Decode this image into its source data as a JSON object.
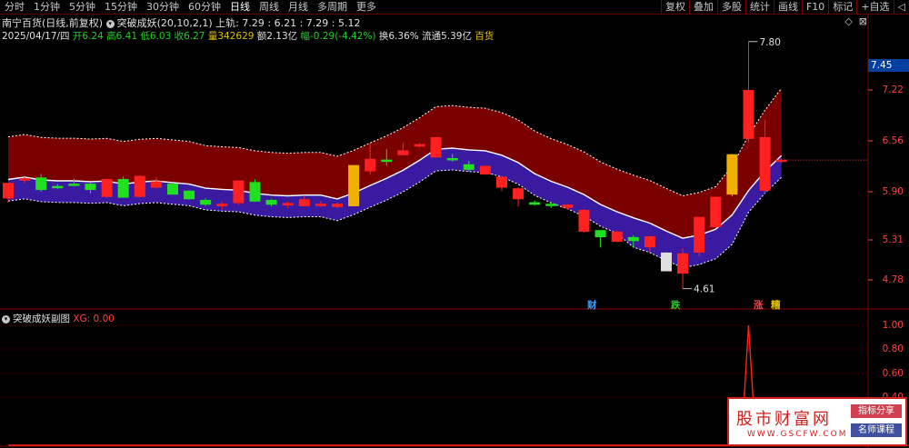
{
  "tabs": [
    "分时",
    "1分钟",
    "5分钟",
    "15分钟",
    "30分钟",
    "60分钟",
    "日线",
    "周线",
    "月线",
    "多周期",
    "更多"
  ],
  "active_tab": 6,
  "tools": [
    "复权",
    "叠加",
    "多股",
    "统计",
    "画线",
    "F10",
    "标记",
    "+自选",
    "◁"
  ],
  "header": {
    "stock_name": "南宁百货",
    "period_label": "(日线,前复权)",
    "indicator_name": "突破成妖",
    "indicator_params": "(20,10,2,1)",
    "upper_label": "上轨: 7.29",
    "vals": [
      ": 6.21",
      ": 7.29",
      ": 5.12"
    ]
  },
  "info": {
    "date": "2025/04/17/四",
    "open": "开6.24",
    "high": "高6.41",
    "low": "低6.03",
    "close": "收6.27",
    "volume": "量342629",
    "amount": "额2.13亿",
    "change": "幅-0.29(-4.42%)",
    "turnover": "换6.36%",
    "float": "流通5.39亿",
    "sector": "百货"
  },
  "sub_indicator": {
    "name": "突破成妖副图",
    "value": "XG: 0.00"
  },
  "price_axis": [
    "7.22",
    "6.56",
    "5.90",
    "5.31",
    "4.78"
  ],
  "sub_axis": [
    "1.00",
    "0.80",
    "0.60",
    "0.40"
  ],
  "current_price": "7.45",
  "annotations": {
    "high": "7.80",
    "low": "4.61"
  },
  "signals": [
    {
      "text": "财",
      "color": "#40a0ff"
    },
    {
      "text": "跌",
      "color": "#20d020"
    },
    {
      "text": "涨",
      "color": "#ff4040"
    },
    {
      "text": "糟",
      "color": "#e0c000"
    }
  ],
  "logo": {
    "main": "股市财富网",
    "sub": "WWW.GSCFW.COM",
    "tag1": "指标分享",
    "tag2": "名师课程"
  },
  "chart_data": {
    "type": "candlestick",
    "ylim": [
      4.5,
      7.95
    ],
    "candles": [
      {
        "o": 5.78,
        "h": 5.98,
        "l": 5.72,
        "c": 5.97
      },
      {
        "o": 6.01,
        "h": 6.05,
        "l": 5.97,
        "c": 6.03
      },
      {
        "o": 6.04,
        "h": 6.09,
        "l": 5.86,
        "c": 5.89
      },
      {
        "o": 5.93,
        "h": 5.96,
        "l": 5.9,
        "c": 5.92
      },
      {
        "o": 5.96,
        "h": 6.03,
        "l": 5.93,
        "c": 5.95
      },
      {
        "o": 5.96,
        "h": 5.98,
        "l": 5.84,
        "c": 5.89
      },
      {
        "o": 5.8,
        "h": 6.03,
        "l": 5.78,
        "c": 6.02
      },
      {
        "o": 6.02,
        "h": 6.06,
        "l": 5.79,
        "c": 5.79
      },
      {
        "o": 5.8,
        "h": 6.07,
        "l": 5.79,
        "c": 6.06
      },
      {
        "o": 5.92,
        "h": 6.05,
        "l": 5.9,
        "c": 5.99
      },
      {
        "o": 5.96,
        "h": 5.98,
        "l": 5.82,
        "c": 5.83
      },
      {
        "o": 5.87,
        "h": 5.87,
        "l": 5.76,
        "c": 5.77
      },
      {
        "o": 5.75,
        "h": 5.78,
        "l": 5.68,
        "c": 5.7
      },
      {
        "o": 5.68,
        "h": 5.73,
        "l": 5.63,
        "c": 5.7
      },
      {
        "o": 5.72,
        "h": 6.01,
        "l": 5.69,
        "c": 6.0
      },
      {
        "o": 5.98,
        "h": 6.02,
        "l": 5.73,
        "c": 5.74
      },
      {
        "o": 5.75,
        "h": 5.77,
        "l": 5.67,
        "c": 5.7
      },
      {
        "o": 5.69,
        "h": 5.73,
        "l": 5.65,
        "c": 5.71
      },
      {
        "o": 5.68,
        "h": 5.8,
        "l": 5.67,
        "c": 5.76
      },
      {
        "o": 5.69,
        "h": 5.74,
        "l": 5.66,
        "c": 5.7
      },
      {
        "o": 5.67,
        "h": 5.72,
        "l": 5.65,
        "c": 5.7
      },
      {
        "o": 5.68,
        "h": 6.2,
        "l": 5.67,
        "c": 6.2
      },
      {
        "o": 6.13,
        "h": 6.49,
        "l": 6.08,
        "c": 6.28
      },
      {
        "o": 6.27,
        "h": 6.41,
        "l": 6.2,
        "c": 6.26
      },
      {
        "o": 6.34,
        "h": 6.49,
        "l": 6.33,
        "c": 6.39
      },
      {
        "o": 6.45,
        "h": 6.49,
        "l": 6.43,
        "c": 6.47
      },
      {
        "o": 6.31,
        "h": 6.56,
        "l": 6.3,
        "c": 6.56
      },
      {
        "o": 6.29,
        "h": 6.35,
        "l": 6.25,
        "c": 6.28
      },
      {
        "o": 6.21,
        "h": 6.26,
        "l": 6.12,
        "c": 6.15
      },
      {
        "o": 6.09,
        "h": 6.2,
        "l": 6.08,
        "c": 6.19
      },
      {
        "o": 5.92,
        "h": 5.99,
        "l": 5.87,
        "c": 6.05
      },
      {
        "o": 5.77,
        "h": 5.92,
        "l": 5.67,
        "c": 5.9
      },
      {
        "o": 5.72,
        "h": 5.75,
        "l": 5.68,
        "c": 5.7
      },
      {
        "o": 5.7,
        "h": 5.73,
        "l": 5.65,
        "c": 5.69
      },
      {
        "o": 5.66,
        "h": 5.7,
        "l": 5.63,
        "c": 5.69
      },
      {
        "o": 5.35,
        "h": 5.64,
        "l": 5.33,
        "c": 5.62
      },
      {
        "o": 5.36,
        "h": 5.36,
        "l": 5.14,
        "c": 5.28
      },
      {
        "o": 5.22,
        "h": 5.36,
        "l": 5.21,
        "c": 5.34
      },
      {
        "o": 5.27,
        "h": 5.3,
        "l": 5.14,
        "c": 5.23
      },
      {
        "o": 5.15,
        "h": 5.29,
        "l": 5.09,
        "c": 5.28
      },
      {
        "o": 4.84,
        "h": 5.08,
        "l": 4.84,
        "c": 5.07
      },
      {
        "o": 4.81,
        "h": 5.13,
        "l": 4.61,
        "c": 5.06
      },
      {
        "o": 5.08,
        "h": 5.53,
        "l": 5.03,
        "c": 5.53
      },
      {
        "o": 5.41,
        "h": 5.78,
        "l": 5.4,
        "c": 5.79
      },
      {
        "o": 5.83,
        "h": 6.35,
        "l": 5.8,
        "c": 6.34
      },
      {
        "o": 6.55,
        "h": 7.8,
        "l": 6.5,
        "c": 7.17
      },
      {
        "o": 5.88,
        "h": 6.79,
        "l": 5.84,
        "c": 6.56
      },
      {
        "o": 6.27,
        "h": 6.29,
        "l": 6.23,
        "c": 6.27
      }
    ]
  }
}
